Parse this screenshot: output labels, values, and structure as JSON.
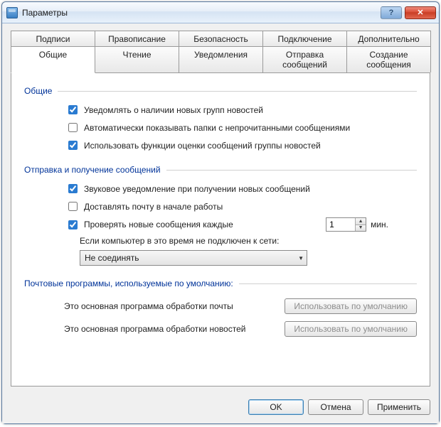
{
  "window": {
    "title": "Параметры"
  },
  "tabs_row1": [
    {
      "label": "Подписи"
    },
    {
      "label": "Правописание"
    },
    {
      "label": "Безопасность"
    },
    {
      "label": "Подключение"
    },
    {
      "label": "Дополнительно"
    }
  ],
  "tabs_row2": [
    {
      "label": "Общие",
      "active": true
    },
    {
      "label": "Чтение"
    },
    {
      "label": "Уведомления"
    },
    {
      "label": "Отправка сообщений"
    },
    {
      "label": "Создание сообщения"
    }
  ],
  "groups": {
    "general": {
      "title": "Общие",
      "opts": {
        "notify_groups": {
          "label": "Уведомлять о наличии новых групп новостей",
          "checked": true
        },
        "auto_show_unread": {
          "label": "Автоматически показывать папки с непрочитанными сообщениями",
          "checked": false
        },
        "use_rating": {
          "label": "Использовать функции оценки сообщений группы новостей",
          "checked": true
        }
      }
    },
    "sendrecv": {
      "title": "Отправка и получение сообщений",
      "opts": {
        "sound_on_new": {
          "label": "Звуковое уведомление при получении новых сообщений",
          "checked": true
        },
        "deliver_on_start": {
          "label": "Доставлять почту в начале работы",
          "checked": false
        },
        "check_every": {
          "label": "Проверять новые сообщения каждые",
          "checked": true,
          "value": "1",
          "unit": "мин."
        }
      },
      "offline": {
        "label": "Если компьютер в это время не подключен к сети:",
        "combo": {
          "selected": "Не соединять"
        }
      }
    },
    "defaults": {
      "title": "Почтовые программы, используемые по умолчанию:",
      "mail": {
        "label": "Это основная программа обработки почты",
        "btn": "Использовать по умолчанию",
        "disabled": true
      },
      "news": {
        "label": "Это основная программа обработки новостей",
        "btn": "Использовать по умолчанию",
        "disabled": true
      }
    }
  },
  "footer": {
    "ok": "OK",
    "cancel": "Отмена",
    "apply": "Применить"
  }
}
